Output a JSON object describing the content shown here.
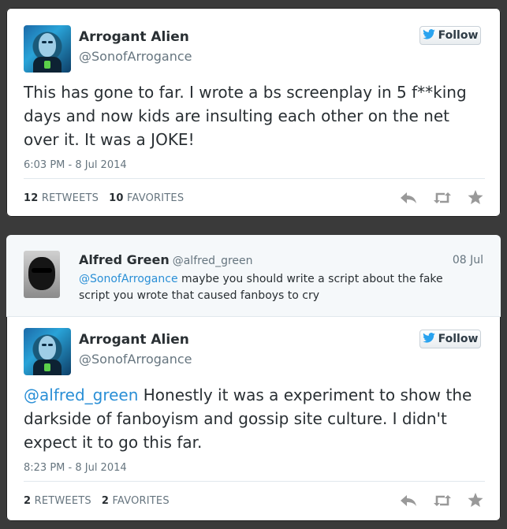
{
  "tweet1": {
    "name": "Arrogant Alien",
    "handle": "@SonofArrogance",
    "follow_label": "Follow",
    "text": "This has gone to far. I wrote a bs screenplay in 5 f**king days and now kids are insulting each other on the net over it. It was a JOKE!",
    "time": "6:03 PM - 8 Jul 2014",
    "retweets_count": "12",
    "retweets_label": "RETWEETS",
    "favorites_count": "10",
    "favorites_label": "FAVORITES"
  },
  "reply": {
    "name": "Alfred Green",
    "handle": "@alfred_green",
    "date": "08 Jul",
    "mention": "@SonofArrogance",
    "text": " maybe you should write a script about the fake script you wrote that caused fanboys to cry"
  },
  "tweet2": {
    "name": "Arrogant Alien",
    "handle": "@SonofArrogance",
    "follow_label": "Follow",
    "mention": "@alfred_green",
    "text": " Honestly it was a experiment to show the darkside of fanboyism and gossip site culture. I didn't expect it to go this far.",
    "time": "8:23 PM - 8 Jul 2014",
    "retweets_count": "2",
    "retweets_label": "RETWEETS",
    "favorites_count": "2",
    "favorites_label": "FAVORITES"
  },
  "icons": {
    "follow": "twitter-bird-icon",
    "reply": "reply-icon",
    "retweet": "retweet-icon",
    "favorite": "star-icon"
  },
  "colors": {
    "link": "#2a8fd6",
    "bird": "#2aa3ef",
    "action_icon": "#999999"
  }
}
